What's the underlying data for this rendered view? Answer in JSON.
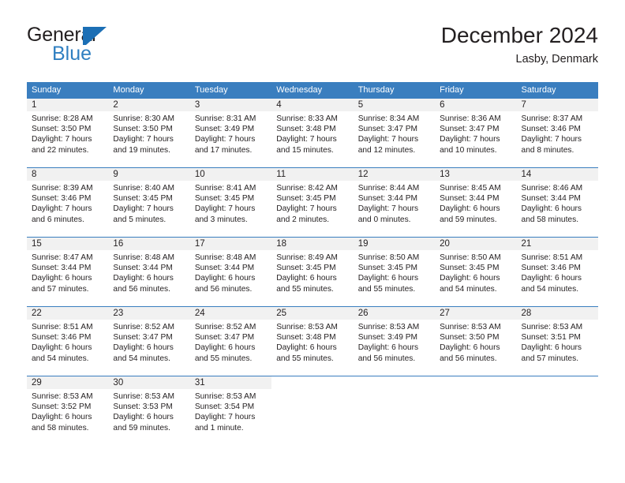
{
  "brand": {
    "name_top": "General",
    "name_bottom": "Blue",
    "color_dark": "#231f20",
    "color_blue": "#2f7fc1"
  },
  "header": {
    "title": "December 2024",
    "location": "Lasby, Denmark"
  },
  "theme": {
    "header_blue": "#3a7ebf",
    "daynum_gray": "#f1f1f1",
    "text": "#231f20"
  },
  "weekday_headers": [
    "Sunday",
    "Monday",
    "Tuesday",
    "Wednesday",
    "Thursday",
    "Friday",
    "Saturday"
  ],
  "weeks": [
    {
      "days": [
        {
          "num": "1",
          "sunrise": "Sunrise: 8:28 AM",
          "sunset": "Sunset: 3:50 PM",
          "daylight_1": "Daylight: 7 hours",
          "daylight_2": "and 22 minutes."
        },
        {
          "num": "2",
          "sunrise": "Sunrise: 8:30 AM",
          "sunset": "Sunset: 3:50 PM",
          "daylight_1": "Daylight: 7 hours",
          "daylight_2": "and 19 minutes."
        },
        {
          "num": "3",
          "sunrise": "Sunrise: 8:31 AM",
          "sunset": "Sunset: 3:49 PM",
          "daylight_1": "Daylight: 7 hours",
          "daylight_2": "and 17 minutes."
        },
        {
          "num": "4",
          "sunrise": "Sunrise: 8:33 AM",
          "sunset": "Sunset: 3:48 PM",
          "daylight_1": "Daylight: 7 hours",
          "daylight_2": "and 15 minutes."
        },
        {
          "num": "5",
          "sunrise": "Sunrise: 8:34 AM",
          "sunset": "Sunset: 3:47 PM",
          "daylight_1": "Daylight: 7 hours",
          "daylight_2": "and 12 minutes."
        },
        {
          "num": "6",
          "sunrise": "Sunrise: 8:36 AM",
          "sunset": "Sunset: 3:47 PM",
          "daylight_1": "Daylight: 7 hours",
          "daylight_2": "and 10 minutes."
        },
        {
          "num": "7",
          "sunrise": "Sunrise: 8:37 AM",
          "sunset": "Sunset: 3:46 PM",
          "daylight_1": "Daylight: 7 hours",
          "daylight_2": "and 8 minutes."
        }
      ]
    },
    {
      "days": [
        {
          "num": "8",
          "sunrise": "Sunrise: 8:39 AM",
          "sunset": "Sunset: 3:46 PM",
          "daylight_1": "Daylight: 7 hours",
          "daylight_2": "and 6 minutes."
        },
        {
          "num": "9",
          "sunrise": "Sunrise: 8:40 AM",
          "sunset": "Sunset: 3:45 PM",
          "daylight_1": "Daylight: 7 hours",
          "daylight_2": "and 5 minutes."
        },
        {
          "num": "10",
          "sunrise": "Sunrise: 8:41 AM",
          "sunset": "Sunset: 3:45 PM",
          "daylight_1": "Daylight: 7 hours",
          "daylight_2": "and 3 minutes."
        },
        {
          "num": "11",
          "sunrise": "Sunrise: 8:42 AM",
          "sunset": "Sunset: 3:45 PM",
          "daylight_1": "Daylight: 7 hours",
          "daylight_2": "and 2 minutes."
        },
        {
          "num": "12",
          "sunrise": "Sunrise: 8:44 AM",
          "sunset": "Sunset: 3:44 PM",
          "daylight_1": "Daylight: 7 hours",
          "daylight_2": "and 0 minutes."
        },
        {
          "num": "13",
          "sunrise": "Sunrise: 8:45 AM",
          "sunset": "Sunset: 3:44 PM",
          "daylight_1": "Daylight: 6 hours",
          "daylight_2": "and 59 minutes."
        },
        {
          "num": "14",
          "sunrise": "Sunrise: 8:46 AM",
          "sunset": "Sunset: 3:44 PM",
          "daylight_1": "Daylight: 6 hours",
          "daylight_2": "and 58 minutes."
        }
      ]
    },
    {
      "days": [
        {
          "num": "15",
          "sunrise": "Sunrise: 8:47 AM",
          "sunset": "Sunset: 3:44 PM",
          "daylight_1": "Daylight: 6 hours",
          "daylight_2": "and 57 minutes."
        },
        {
          "num": "16",
          "sunrise": "Sunrise: 8:48 AM",
          "sunset": "Sunset: 3:44 PM",
          "daylight_1": "Daylight: 6 hours",
          "daylight_2": "and 56 minutes."
        },
        {
          "num": "17",
          "sunrise": "Sunrise: 8:48 AM",
          "sunset": "Sunset: 3:44 PM",
          "daylight_1": "Daylight: 6 hours",
          "daylight_2": "and 56 minutes."
        },
        {
          "num": "18",
          "sunrise": "Sunrise: 8:49 AM",
          "sunset": "Sunset: 3:45 PM",
          "daylight_1": "Daylight: 6 hours",
          "daylight_2": "and 55 minutes."
        },
        {
          "num": "19",
          "sunrise": "Sunrise: 8:50 AM",
          "sunset": "Sunset: 3:45 PM",
          "daylight_1": "Daylight: 6 hours",
          "daylight_2": "and 55 minutes."
        },
        {
          "num": "20",
          "sunrise": "Sunrise: 8:50 AM",
          "sunset": "Sunset: 3:45 PM",
          "daylight_1": "Daylight: 6 hours",
          "daylight_2": "and 54 minutes."
        },
        {
          "num": "21",
          "sunrise": "Sunrise: 8:51 AM",
          "sunset": "Sunset: 3:46 PM",
          "daylight_1": "Daylight: 6 hours",
          "daylight_2": "and 54 minutes."
        }
      ]
    },
    {
      "days": [
        {
          "num": "22",
          "sunrise": "Sunrise: 8:51 AM",
          "sunset": "Sunset: 3:46 PM",
          "daylight_1": "Daylight: 6 hours",
          "daylight_2": "and 54 minutes."
        },
        {
          "num": "23",
          "sunrise": "Sunrise: 8:52 AM",
          "sunset": "Sunset: 3:47 PM",
          "daylight_1": "Daylight: 6 hours",
          "daylight_2": "and 54 minutes."
        },
        {
          "num": "24",
          "sunrise": "Sunrise: 8:52 AM",
          "sunset": "Sunset: 3:47 PM",
          "daylight_1": "Daylight: 6 hours",
          "daylight_2": "and 55 minutes."
        },
        {
          "num": "25",
          "sunrise": "Sunrise: 8:53 AM",
          "sunset": "Sunset: 3:48 PM",
          "daylight_1": "Daylight: 6 hours",
          "daylight_2": "and 55 minutes."
        },
        {
          "num": "26",
          "sunrise": "Sunrise: 8:53 AM",
          "sunset": "Sunset: 3:49 PM",
          "daylight_1": "Daylight: 6 hours",
          "daylight_2": "and 56 minutes."
        },
        {
          "num": "27",
          "sunrise": "Sunrise: 8:53 AM",
          "sunset": "Sunset: 3:50 PM",
          "daylight_1": "Daylight: 6 hours",
          "daylight_2": "and 56 minutes."
        },
        {
          "num": "28",
          "sunrise": "Sunrise: 8:53 AM",
          "sunset": "Sunset: 3:51 PM",
          "daylight_1": "Daylight: 6 hours",
          "daylight_2": "and 57 minutes."
        }
      ]
    },
    {
      "days": [
        {
          "num": "29",
          "sunrise": "Sunrise: 8:53 AM",
          "sunset": "Sunset: 3:52 PM",
          "daylight_1": "Daylight: 6 hours",
          "daylight_2": "and 58 minutes."
        },
        {
          "num": "30",
          "sunrise": "Sunrise: 8:53 AM",
          "sunset": "Sunset: 3:53 PM",
          "daylight_1": "Daylight: 6 hours",
          "daylight_2": "and 59 minutes."
        },
        {
          "num": "31",
          "sunrise": "Sunrise: 8:53 AM",
          "sunset": "Sunset: 3:54 PM",
          "daylight_1": "Daylight: 7 hours",
          "daylight_2": "and 1 minute."
        },
        {
          "num": "",
          "sunrise": "",
          "sunset": "",
          "daylight_1": "",
          "daylight_2": ""
        },
        {
          "num": "",
          "sunrise": "",
          "sunset": "",
          "daylight_1": "",
          "daylight_2": ""
        },
        {
          "num": "",
          "sunrise": "",
          "sunset": "",
          "daylight_1": "",
          "daylight_2": ""
        },
        {
          "num": "",
          "sunrise": "",
          "sunset": "",
          "daylight_1": "",
          "daylight_2": ""
        }
      ]
    }
  ]
}
